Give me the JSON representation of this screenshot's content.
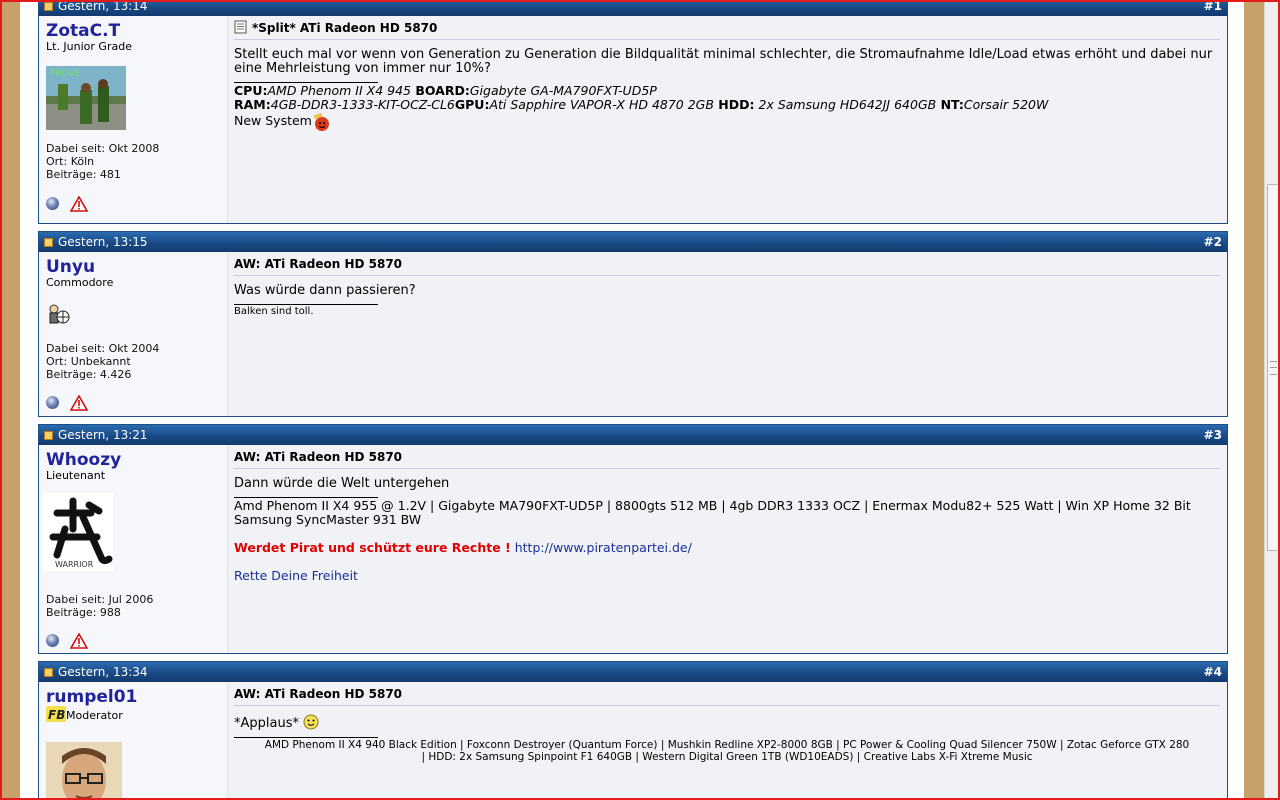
{
  "colors": {
    "header_blue": "#1a4a86",
    "username_blue": "#22229a",
    "link_blue": "#1a2f9a",
    "alert_red": "#e00000",
    "frame_red": "#e31b1b"
  },
  "posts": [
    {
      "time": "Gestern, 13:14",
      "number": "#1",
      "username": "ZotaC.T",
      "usertitle": "Lt. Junior Grade",
      "joined": "Dabei seit: Okt 2008",
      "location": "Ort: Köln",
      "posts_count": "Beiträge: 481",
      "title": "*Split* ATi Radeon HD 5870",
      "text": "Stellt euch mal vor wenn von Generation zu Generation die Bildqualität minimal schlechter, die Stromaufnahme Idle/Load etwas erhöht und dabei nur eine Mehrleistung von immer nur 10%?",
      "sig": {
        "cpu_label": "CPU:",
        "cpu_value": "AMD Phenom II X4 945",
        "board_label": " BOARD:",
        "board_value": "Gigabyte GA-MA790FXT-UD5P",
        "ram_label": "RAM:",
        "ram_value": "4GB-DDR3-1333-KIT-OCZ-CL6",
        "gpu_label": "GPU:",
        "gpu_value": "Ati Sapphire VAPOR-X HD 4870 2GB",
        "hdd_label": " HDD:",
        "hdd_value": " 2x Samsung HD642JJ 640GB",
        "nt_label": " NT:",
        "nt_value": "Corsair 520W",
        "last_line": "New System"
      }
    },
    {
      "time": "Gestern, 13:15",
      "number": "#2",
      "username": "Unyu",
      "usertitle": "Commodore",
      "joined": "Dabei seit: Okt 2004",
      "location": "Ort: Unbekannt",
      "posts_count": "Beiträge: 4.426",
      "title": "AW: ATi Radeon HD 5870",
      "text": "Was würde dann passieren?",
      "sig_text": "Balken sind toll."
    },
    {
      "time": "Gestern, 13:21",
      "number": "#3",
      "username": "Whoozy",
      "usertitle": "Lieutenant",
      "avatar_caption": "WARRIOR",
      "joined": "Dabei seit: Jul 2006",
      "posts_count": "Beiträge: 988",
      "title": "AW: ATi Radeon HD 5870",
      "text": "Dann würde die Welt untergehen",
      "sig_line1": "Amd Phenom II X4 955 @ 1.2V | Gigabyte MA790FXT-UD5P | 8800gts 512 MB | 4gb DDR3 1333 OCZ | Enermax Modu82+ 525 Watt | Win XP Home 32 Bit",
      "sig_line2": "Samsung SyncMaster 931 BW",
      "pirate_text": "Werdet Pirat und schützt eure Rechte !",
      "pirate_link": "http://www.piratenpartei.de/",
      "freedom_link": "Rette Deine Freiheit"
    },
    {
      "time": "Gestern, 13:34",
      "number": "#4",
      "username": "rumpel01",
      "usertitle": "Moderator",
      "title": "AW: ATi Radeon HD 5870",
      "text": "*Applaus*",
      "sig_line1": "AMD Phenom II X4 940 Black Edition | Foxconn Destroyer (Quantum Force) | Mushkin Redline XP2-8000 8GB | PC Power & Cooling Quad Silencer 750W | Zotac Geforce GTX 280",
      "sig_line2": "| HDD: 2x Samsung Spinpoint F1 640GB | Western Digital Green 1TB (WD10EADS) | Creative Labs X-Fi Xtreme Music"
    }
  ]
}
